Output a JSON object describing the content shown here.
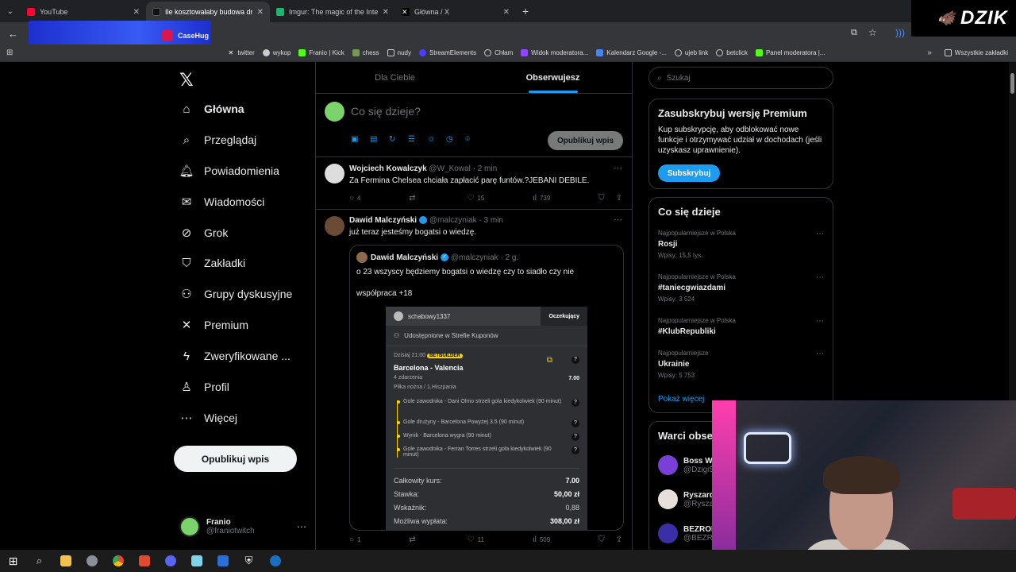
{
  "browser": {
    "tabs": [
      {
        "title": "YouTube",
        "color": "#ff0033",
        "active": false
      },
      {
        "title": "Ile kosztowałaby budowa drona",
        "color": "#111111",
        "active": true
      },
      {
        "title": "Imgur: The magic of the Interne",
        "color": "#1bb76e",
        "active": false
      },
      {
        "title": "Główna / X",
        "color": "#000000",
        "active": false
      }
    ],
    "ad_logo": "CaseHug",
    "bookmarks": [
      "twitter",
      "wykop",
      "Franio | Kick",
      "chess",
      "nudy",
      "StreamElements",
      "Chłam",
      "Widok moderatora...",
      "Kalendarz Google -...",
      "ujeb link",
      "betclick",
      "Panel moderatora |..."
    ],
    "all_bookmarks": "Wszystkie zakładki",
    "overlay_brand": "DZIK"
  },
  "nav": {
    "items": [
      {
        "label": "Główna",
        "icon": "home-icon",
        "glyph": "⌂",
        "bold": true
      },
      {
        "label": "Przeglądaj",
        "icon": "search-icon",
        "glyph": "⌕"
      },
      {
        "label": "Powiadomienia",
        "icon": "bell-icon",
        "glyph": "♫"
      },
      {
        "label": "Wiadomości",
        "icon": "mail-icon",
        "glyph": "✉"
      },
      {
        "label": "Grok",
        "icon": "grok-icon",
        "glyph": "⊘"
      },
      {
        "label": "Zakładki",
        "icon": "bookmark-icon",
        "glyph": "⛉"
      },
      {
        "label": "Grupy dyskusyjne",
        "icon": "people-icon",
        "glyph": "☺"
      },
      {
        "label": "Premium",
        "icon": "x-icon",
        "glyph": "✕"
      },
      {
        "label": "Zweryfikowane ...",
        "icon": "lightning-icon",
        "glyph": "ϟ"
      },
      {
        "label": "Profil",
        "icon": "person-icon",
        "glyph": "♙"
      },
      {
        "label": "Więcej",
        "icon": "more-icon",
        "glyph": "⋯"
      }
    ],
    "post_button": "Opublikuj wpis",
    "profile": {
      "name": "Franio",
      "handle": "@franiotwitch"
    }
  },
  "feed": {
    "tabs": [
      "Dla Ciebie",
      "Obserwujesz"
    ],
    "compose_placeholder": "Co się dzieje?",
    "publish": "Opublikuj wpis",
    "tweets": [
      {
        "name": "Wojciech Kowalczyk",
        "handle": "@W_Kowal",
        "time": "· 2 min",
        "text": "Za Fermina Chelsea chciała zapłacić parę funtów.?JEBANI DEBILE.",
        "replies": "4",
        "likes": "15",
        "views": "739"
      },
      {
        "name": "Dawid Malczyński",
        "handle": "@malczyniak",
        "time": "· 3 min",
        "text": "już teraz jesteśmy bogatsi o wiedzę.",
        "replies": "1",
        "likes": "11",
        "views": "509",
        "quote": {
          "name": "Dawid Malczyński",
          "handle": "@malczyniak",
          "time": "· 2 g.",
          "line1": "o 23 wszyscy będziemy bogatsi o wiedzę czy to siadło czy nie",
          "line2": "współpraca +18"
        }
      }
    ],
    "bet": {
      "user": "schabowy1337",
      "status": "Oczekujący",
      "shared": "Udostępnione w Strefie Kuponów",
      "date": "Dzisiaj 21:00",
      "badge": "BETBUILDER",
      "match": "Barcelona - Valencia",
      "events": "4 zdarzenia",
      "league": "Piłka nożna / 1.Hiszpania",
      "odds": "7.00",
      "selections": [
        "Gole zawodnika - Dani Olmo strzeli gola kiedykolwiek (90 minut)",
        "Gole drużyny - Barcelona Powyżej 3.5 (90 minut)",
        "Wynik - Barcelona wygra (90 minut)",
        "Gole zawodnika - Ferran Torres strzeli gola kiedykolwiek (90 minut)"
      ],
      "summary": [
        {
          "label": "Całkowity kurs:",
          "value": "7.00"
        },
        {
          "label": "Stawka:",
          "value": "50,00 zł"
        },
        {
          "label": "Wskaźnik:",
          "value": "0,88"
        },
        {
          "label": "Możliwa wypłata:",
          "value": "308,00 zł"
        }
      ]
    }
  },
  "right": {
    "search_placeholder": "Szukaj",
    "premium": {
      "title": "Zasubskrybuj wersję Premium",
      "text": "Kup subskrypcję, aby odblokować nowe funkcje i otrzymywać udział w dochodach (jeśli uzyskasz uprawnienie).",
      "button": "Subskrybuj"
    },
    "trends_title": "Co się dzieje",
    "trends": [
      {
        "cat": "Najpopularniejsze w Polska",
        "name": "Rosji",
        "count": "Wpisy: 15,5 tys."
      },
      {
        "cat": "Najpopularniejsze w Polska",
        "name": "#taniecgwiazdami",
        "count": "Wpisy: 3 524"
      },
      {
        "cat": "Najpopularniejsze w Polska",
        "name": "#KlubRepubliki",
        "count": ""
      },
      {
        "cat": "Najpopularniejsze",
        "name": "Ukrainie",
        "count": "Wpisy: 5 753"
      }
    ],
    "show_more": "Pokaż więcej",
    "follow_title": "Warci obse",
    "follow": [
      {
        "name": "Boss Wi",
        "handle": "@DzigiS",
        "color": "#7a3fd6"
      },
      {
        "name": "Ryszard",
        "handle": "@Ryszar",
        "color": "#e7e0da"
      },
      {
        "name": "BEZROE",
        "handle": "@BEZRO",
        "color": "#3b2fa8"
      }
    ]
  }
}
